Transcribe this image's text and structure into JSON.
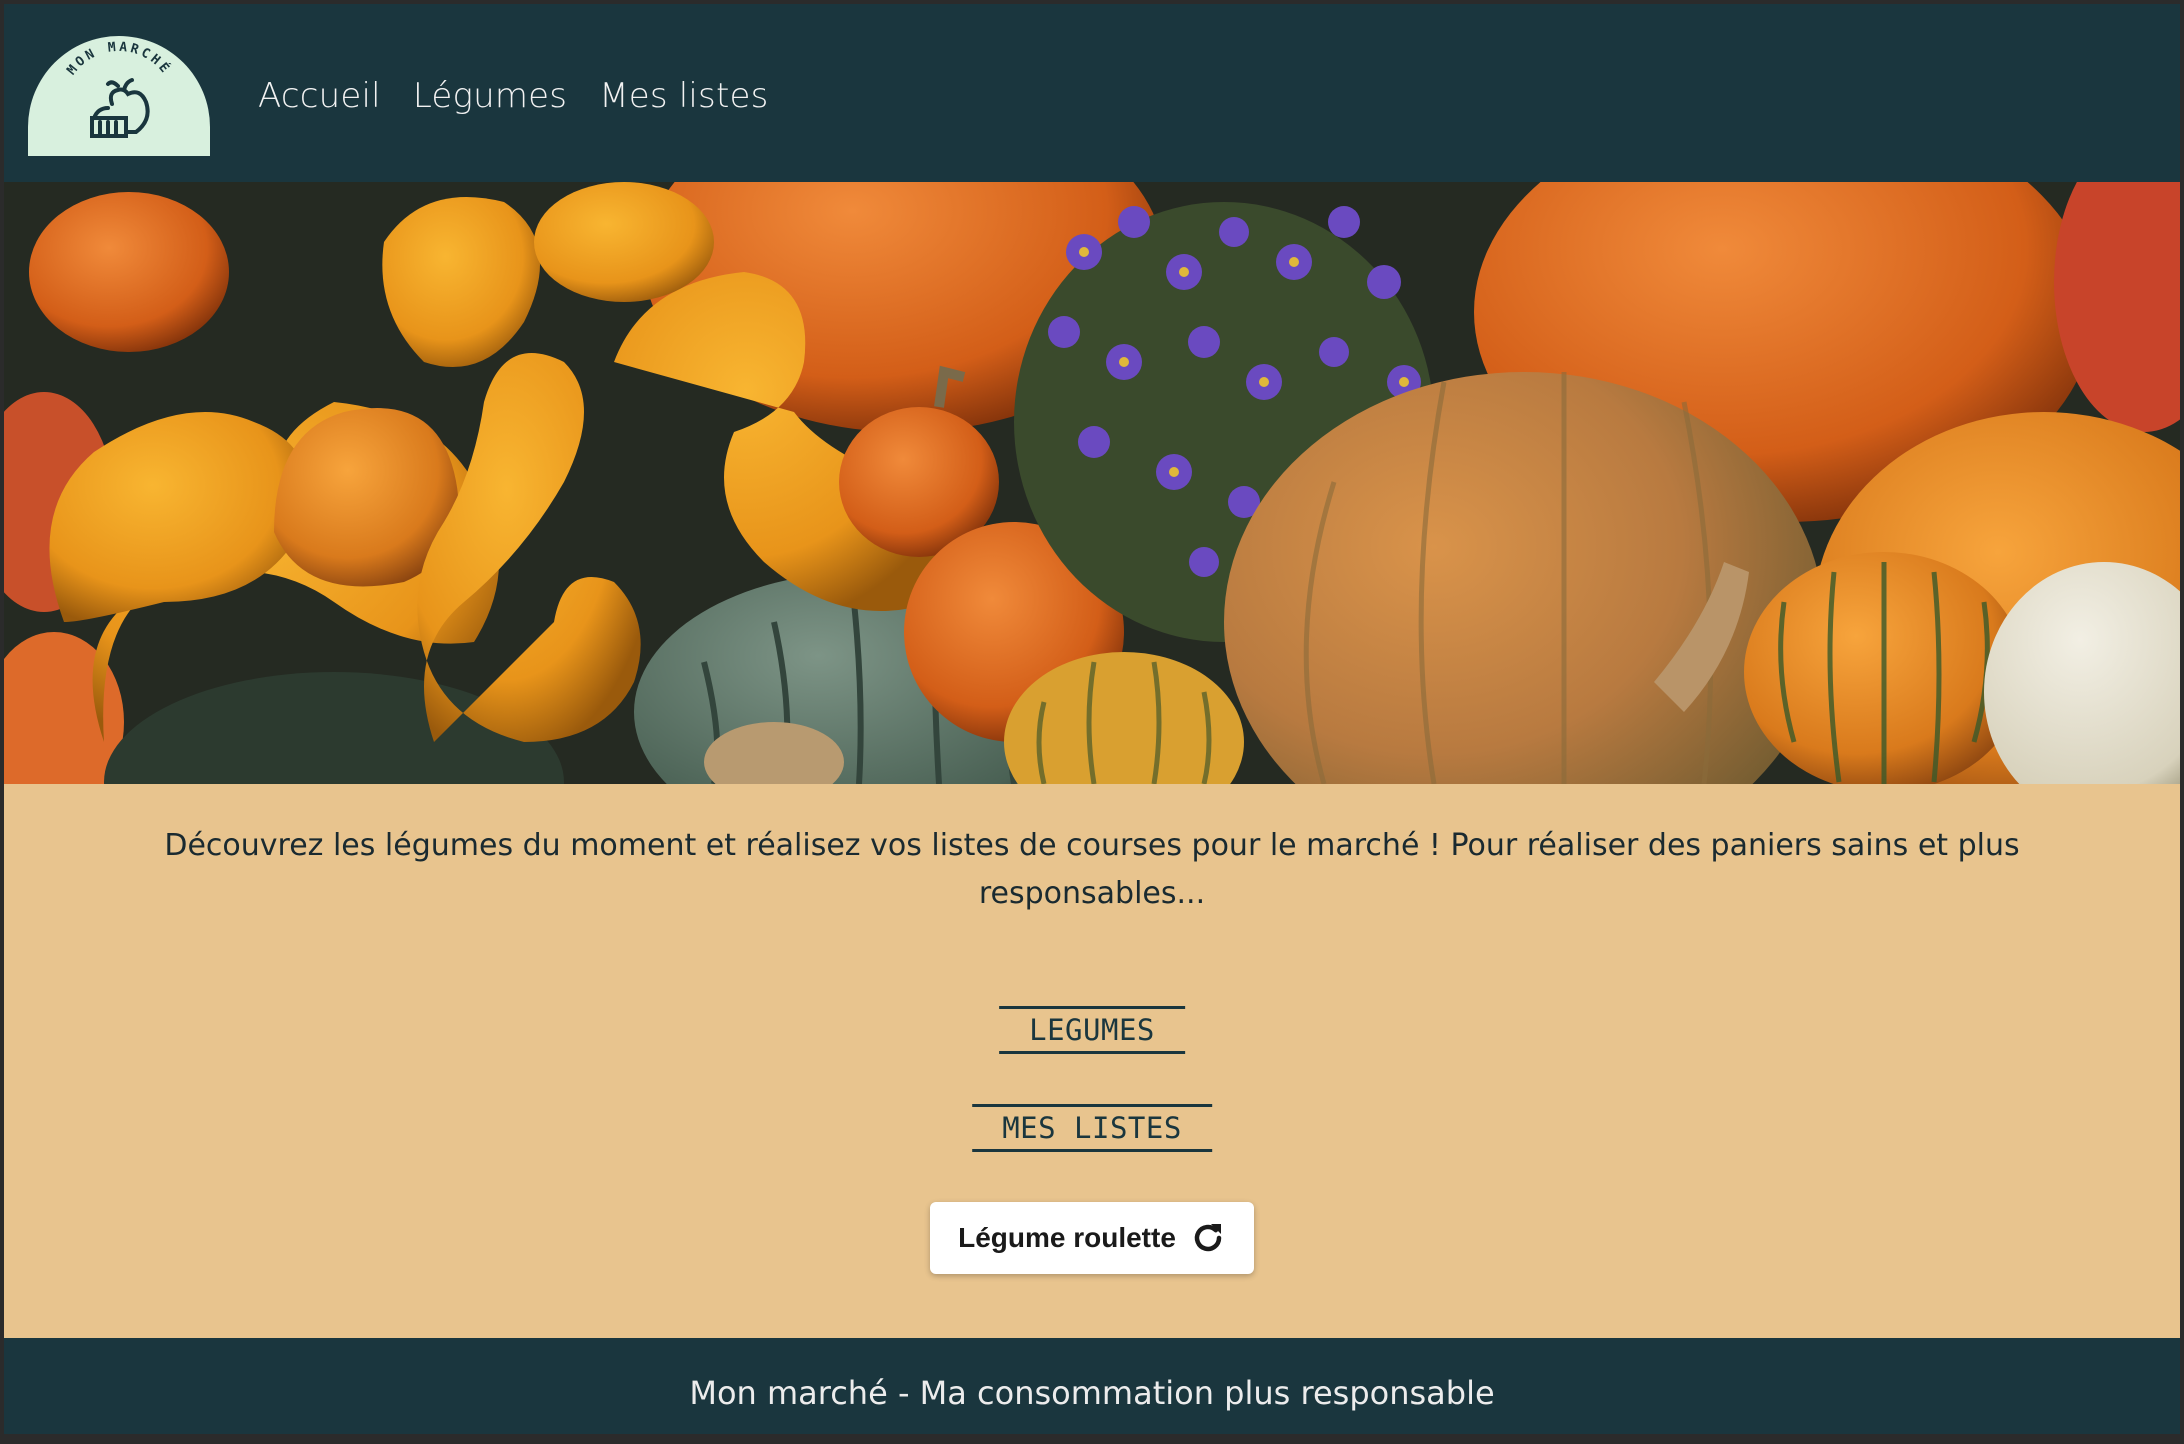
{
  "header": {
    "logo_text": "MON MARCHÉ",
    "nav": [
      {
        "label": "Accueil"
      },
      {
        "label": "Légumes"
      },
      {
        "label": "Mes listes"
      }
    ]
  },
  "intro": {
    "text": "Découvrez les légumes du moment et réalisez vos listes de courses pour le marché ! Pour réaliser des paniers sains et plus responsables..."
  },
  "buttons": {
    "legumes": "LEGUMES",
    "mes_listes": "MES LISTES",
    "roulette": "Légume roulette"
  },
  "footer": {
    "text": "Mon marché - Ma consommation plus responsable"
  },
  "colors": {
    "header_bg": "#1a363e",
    "body_bg": "#e8c48e",
    "logo_bg": "#d8f0de"
  }
}
